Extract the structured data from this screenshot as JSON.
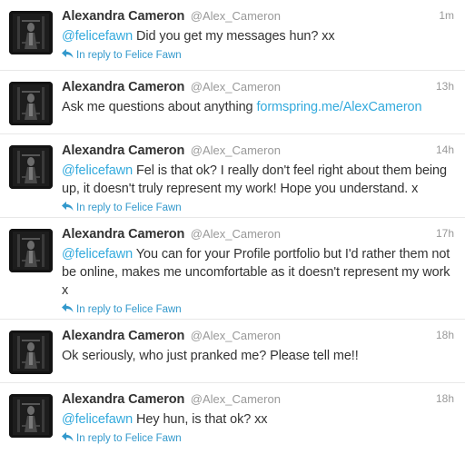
{
  "tweets": [
    {
      "fullname": "Alexandra Cameron",
      "username": "@Alex_Cameron",
      "time": "1m",
      "mention": "@felicefawn",
      "text": " Did you get my messages hun? xx",
      "link": "",
      "reply": "In reply to Felice Fawn"
    },
    {
      "fullname": "Alexandra Cameron",
      "username": "@Alex_Cameron",
      "time": "13h",
      "mention": "",
      "text": "Ask me questions about anything ",
      "link": "formspring.me/AlexCameron",
      "reply": ""
    },
    {
      "fullname": "Alexandra Cameron",
      "username": "@Alex_Cameron",
      "time": "14h",
      "mention": "@felicefawn",
      "text": " Fel is that ok? I really don't feel right about them being up, it doesn't truly represent my work! Hope you understand. x",
      "link": "",
      "reply": "In reply to Felice Fawn"
    },
    {
      "fullname": "Alexandra Cameron",
      "username": "@Alex_Cameron",
      "time": "17h",
      "mention": "@felicefawn",
      "text": " You can for your Profile portfolio but I'd rather them not be online, makes me uncomfortable as it doesn't represent my work x",
      "link": "",
      "reply": "In reply to Felice Fawn"
    },
    {
      "fullname": "Alexandra Cameron",
      "username": "@Alex_Cameron",
      "time": "18h",
      "mention": "",
      "text": "Ok seriously, who just pranked me? Please tell me!!",
      "link": "",
      "reply": ""
    },
    {
      "fullname": "Alexandra Cameron",
      "username": "@Alex_Cameron",
      "time": "18h",
      "mention": "@felicefawn",
      "text": " Hey hun, is that ok? xx",
      "link": "",
      "reply": "In reply to Felice Fawn"
    }
  ],
  "icons": {
    "reply": "reply-arrow-icon",
    "avatar": "profile-photo"
  },
  "colors": {
    "link": "#33aadd",
    "reply": "#3399cc",
    "muted": "#999999",
    "text": "#333333"
  }
}
